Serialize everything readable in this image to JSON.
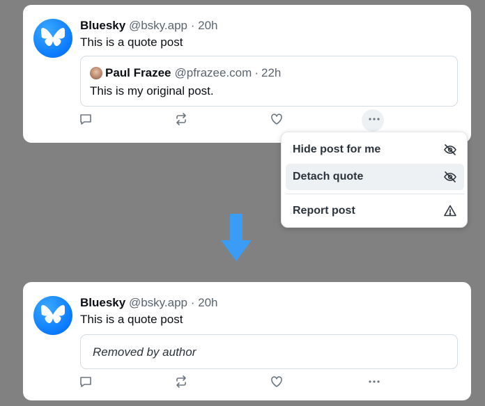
{
  "colors": {
    "background": "#818181",
    "card": "#ffffff",
    "brand_blue": "#0a7aff",
    "arrow_blue": "#3b9cf5",
    "muted_text": "#5a6470"
  },
  "before": {
    "author_name": "Bluesky",
    "author_handle": "@bsky.app",
    "separator": "·",
    "time": "20h",
    "text": "This is a quote post",
    "quote": {
      "author_name": "Paul Frazee",
      "author_handle": "@pfrazee.com",
      "separator": "·",
      "time": "22h",
      "text": "This is my original post."
    },
    "actions": [
      "reply-icon",
      "repost-icon",
      "like-icon",
      "more-icon"
    ]
  },
  "menu": {
    "items": [
      {
        "label": "Hide post for me",
        "icon": "eye-slash-icon"
      },
      {
        "label": "Detach quote",
        "icon": "eye-slash-icon",
        "highlighted": true
      },
      {
        "label": "Report post",
        "icon": "warning-icon"
      }
    ]
  },
  "after": {
    "author_name": "Bluesky",
    "author_handle": "@bsky.app",
    "separator": "·",
    "time": "20h",
    "text": "This is a quote post",
    "removed_text": "Removed by author",
    "actions": [
      "reply-icon",
      "repost-icon",
      "like-icon",
      "more-icon"
    ]
  }
}
